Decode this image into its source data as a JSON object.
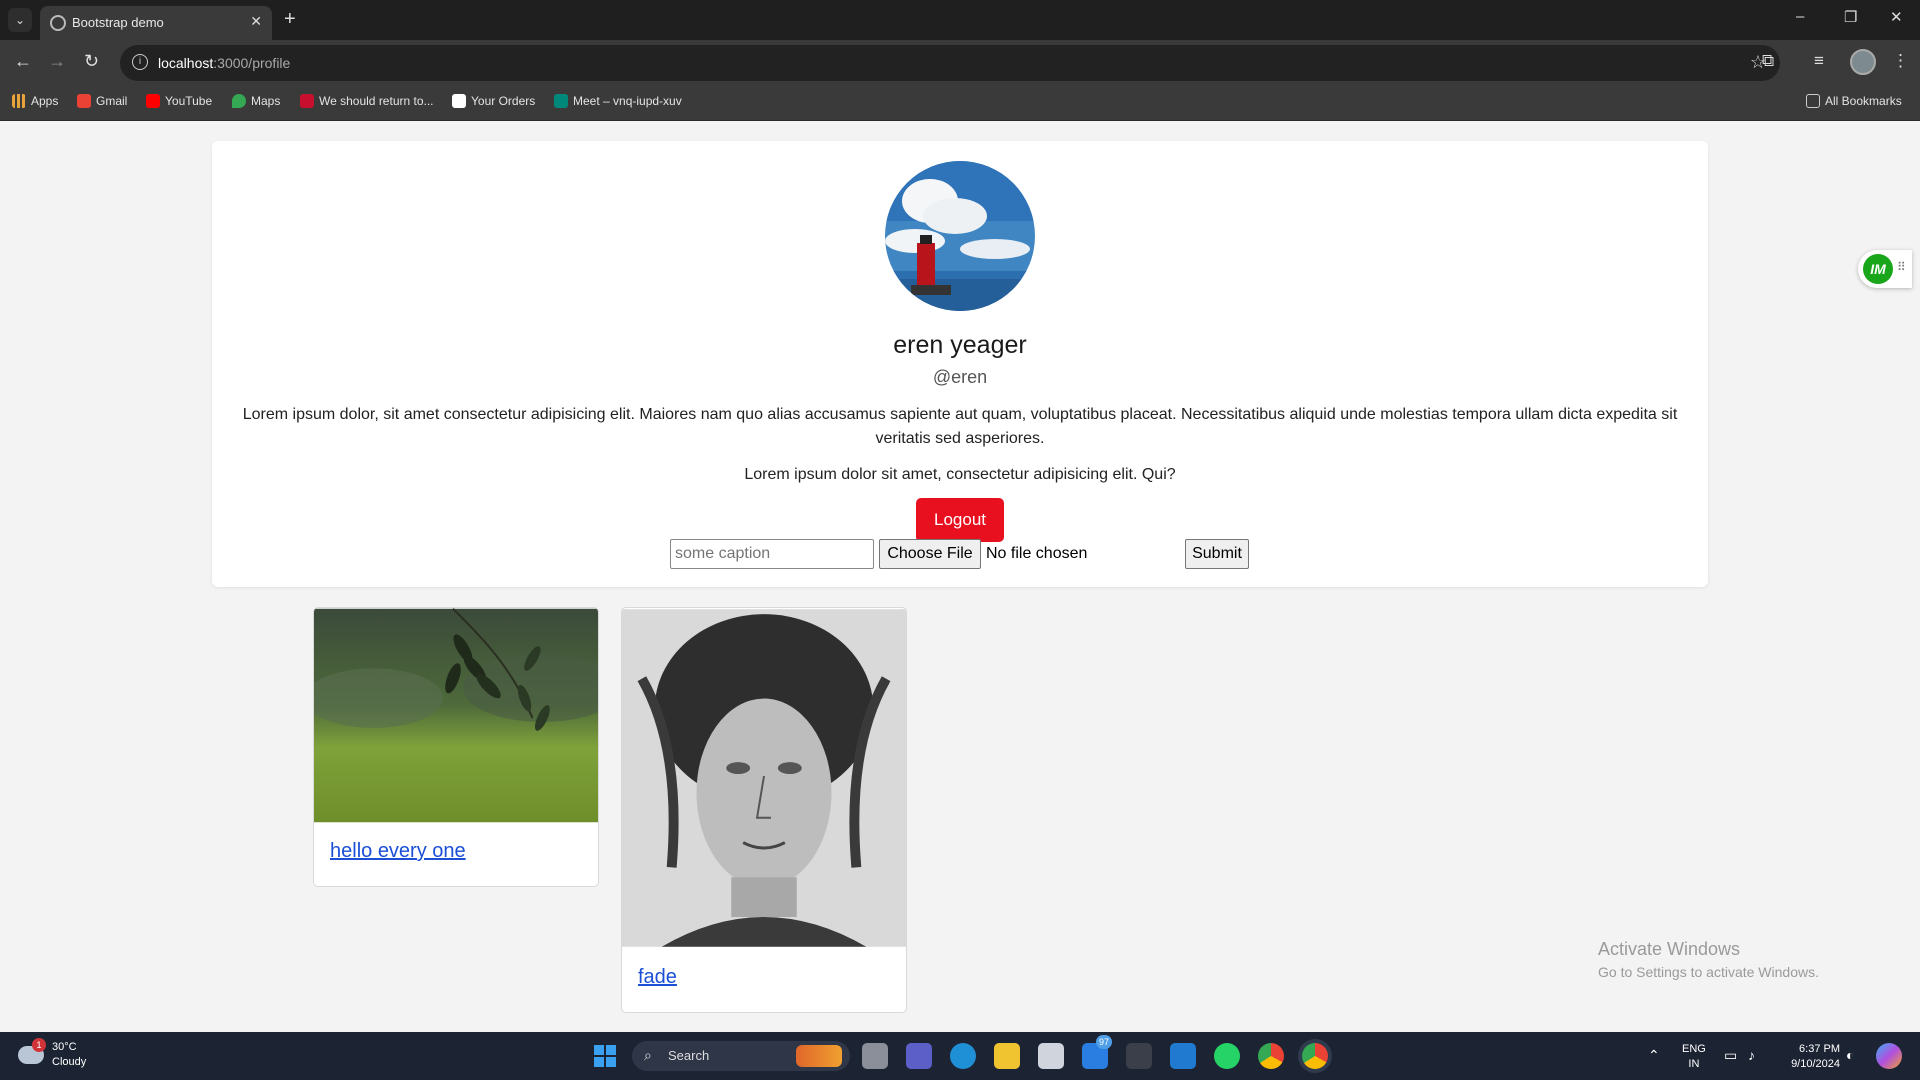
{
  "browser": {
    "tab_menu_icon": "chevron-down-icon",
    "tab_title": "Bootstrap demo",
    "tab_close_glyph": "✕",
    "new_tab_glyph": "+",
    "window_controls": [
      "–",
      "❐",
      "✕"
    ],
    "nav": {
      "back": "←",
      "forward": "→",
      "reload": "↻"
    },
    "url_host": "localhost",
    "url_path": ":3000/profile",
    "star_glyph": "☆",
    "bookmarks": [
      "Apps",
      "Gmail",
      "YouTube",
      "Maps",
      "We should return to...",
      "Your Orders",
      "Meet – vnq-iupd-xuv"
    ],
    "all_bookmarks": "All Bookmarks"
  },
  "profile": {
    "full_name": "eren yeager",
    "username": "@eren",
    "bio": "Lorem ipsum dolor, sit amet consectetur adipisicing elit. Maiores nam quo alias accusamus sapiente aut quam, voluptatibus placeat. Necessitatibus aliquid unde molestias tempora ullam dicta expedita sit veritatis sed asperiores.",
    "bio_secondary": "Lorem ipsum dolor sit amet, consectetur adipisicing elit. Qui?",
    "logout_label": "Logout"
  },
  "upload": {
    "caption_placeholder": "some caption",
    "choose_file_label": "Choose File",
    "file_status": "No file chosen",
    "submit_label": "Submit"
  },
  "posts": [
    {
      "caption": "hello every one"
    },
    {
      "caption": "fade"
    }
  ],
  "extension": {
    "logo_text": "IM",
    "grip_glyph": "⠿"
  },
  "watermark": {
    "title": "Activate Windows",
    "subtitle": "Go to Settings to activate Windows."
  },
  "taskbar": {
    "weather_temp": "30°C",
    "weather_desc": "Cloudy",
    "weather_badge": "1",
    "search_label": "Search",
    "mail_badge": "97",
    "lang_top": "ENG",
    "lang_bottom": "IN",
    "time": "6:37 PM",
    "date": "9/10/2024"
  },
  "colors": {
    "logout_bg": "#e8101f",
    "link": "#1a4fd6",
    "page_bg": "#f3f3f3"
  }
}
